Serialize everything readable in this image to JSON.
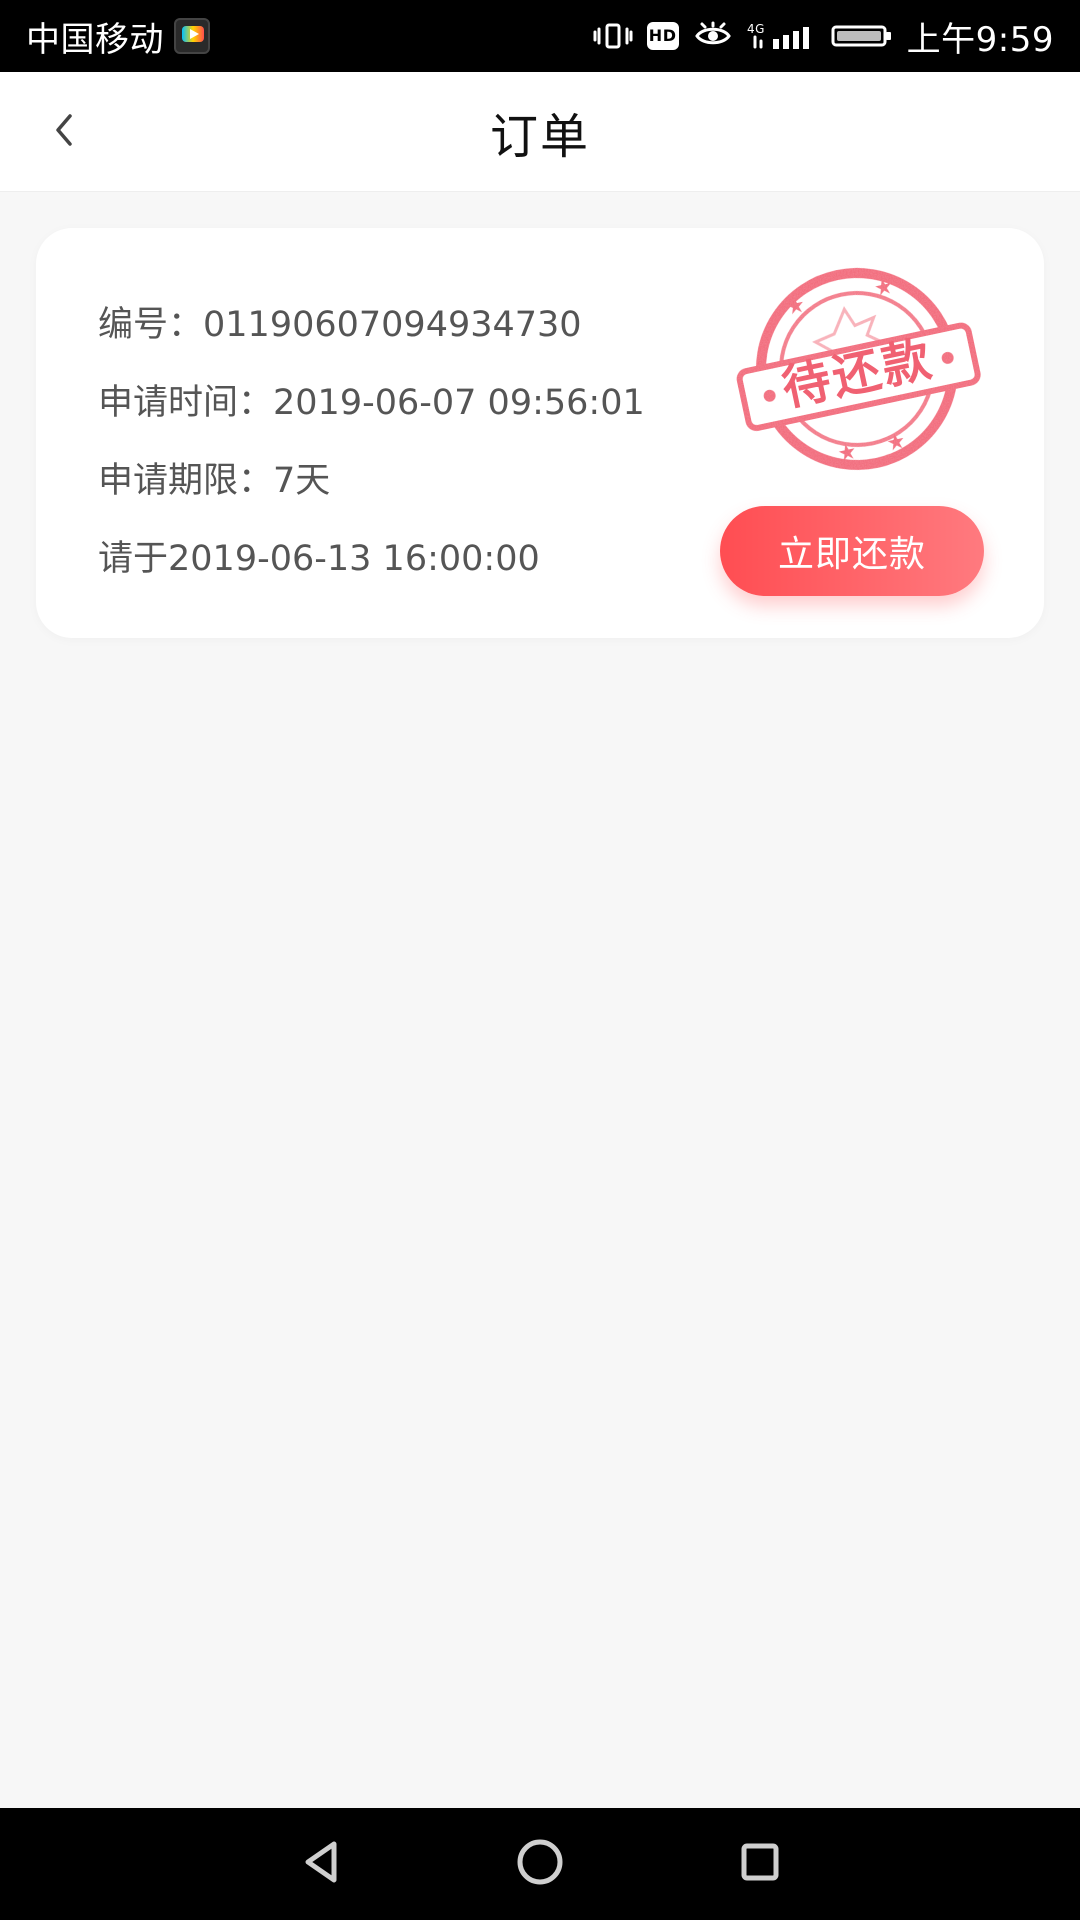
{
  "status_bar": {
    "carrier": "中国移动",
    "time": "上午9:59",
    "hd_label": "HD",
    "network_label": "4G",
    "icons": [
      "vibrate-icon",
      "hd-icon",
      "eye-icon",
      "signal-icon",
      "battery-icon"
    ]
  },
  "header": {
    "title": "订单"
  },
  "order": {
    "number_label": "编号：",
    "number_value": "01190607094934730",
    "apply_time_label": "申请时间：",
    "apply_time_value": "2019-06-07 09:56:01",
    "apply_term_label": "申请期限：",
    "apply_term_value": "7天",
    "due_prefix": "请于",
    "due_value": "2019-06-13 16:00:00",
    "status_stamp": "待还款",
    "repay_button_label": "立即还款"
  },
  "nav_bar": {
    "icons": [
      "back-triangle-icon",
      "home-circle-icon",
      "recent-square-icon"
    ]
  },
  "colors": {
    "accent_red": "#ff4d52",
    "stamp_red": "#f0596b",
    "status_bar_bg": "#000000",
    "header_bg": "#ffffff",
    "content_bg": "#f7f7f7"
  }
}
